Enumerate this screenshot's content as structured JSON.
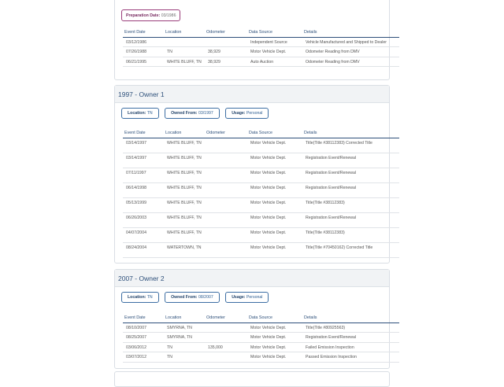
{
  "card0": {
    "prep_label": "Preparation Date:",
    "prep_value": "03/1986",
    "headers": [
      "Event Date",
      "Location",
      "Odometer",
      "Data Source",
      "Details"
    ],
    "rows": [
      [
        "03/12/1986",
        "",
        "",
        "Independent Source",
        "Vehicle Manufactured and Shipped to Dealer"
      ],
      [
        "07/26/1988",
        "TN",
        "38,929",
        "Motor Vehicle Dept.",
        "Odometer Reading from DMV"
      ],
      [
        "06/21/1995",
        "WHITE BLUFF, TN",
        "38,929",
        "Auto Auction",
        "Odometer Reading from DMV"
      ]
    ]
  },
  "owner1": {
    "title": "1997 - Owner   1",
    "location_label": "Location:",
    "location_value": "TN",
    "owned_label": "Owned From:",
    "owned_value": "03/1997",
    "usage_label": "Usage:",
    "usage_value": "Personal",
    "headers": [
      "Event Date",
      "Location",
      "Odometer",
      "Data Source",
      "Details"
    ],
    "rows": [
      [
        "03/14/1997",
        "WHITE BLUFF, TN",
        "",
        "Motor Vehicle Dept.",
        "Title(Title #38112383) Corrected Title"
      ],
      [
        "03/14/1997",
        "WHITE BLUFF, TN",
        "",
        "Motor Vehicle Dept.",
        "Registration Event/Renewal"
      ],
      [
        "07/11/1997",
        "WHITE BLUFF, TN",
        "",
        "Motor Vehicle Dept.",
        "Registration Event/Renewal"
      ],
      [
        "06/14/1998",
        "WHITE BLUFF, TN",
        "",
        "Motor Vehicle Dept.",
        "Registration Event/Renewal"
      ],
      [
        "05/13/1999",
        "WHITE BLUFF, TN",
        "",
        "Motor Vehicle Dept.",
        "Title(Title #38112383)"
      ],
      [
        "06/26/2003",
        "WHITE BLUFF, TN",
        "",
        "Motor Vehicle Dept.",
        "Registration Event/Renewal"
      ],
      [
        "04/07/2004",
        "WHITE BLUFF, TN",
        "",
        "Motor Vehicle Dept.",
        "Title(Title #38112383)"
      ],
      [
        "08/24/2004",
        "WATERTOWN, TN",
        "",
        "Motor Vehicle Dept.",
        "Title(Title #70450162) Corrected Title"
      ]
    ]
  },
  "owner2": {
    "title": "2007 - Owner   2",
    "location_label": "Location:",
    "location_value": "TN",
    "owned_label": "Owned From:",
    "owned_value": "08/2007",
    "usage_label": "Usage:",
    "usage_value": "Personal",
    "headers": [
      "Event Date",
      "Location",
      "Odometer",
      "Data Source",
      "Details"
    ],
    "rows": [
      [
        "08/10/2007",
        "SMYRNA, TN",
        "",
        "Motor Vehicle Dept.",
        "Title(Title #80925563)"
      ],
      [
        "08/25/2007",
        "SMYRNA, TN",
        "",
        "Motor Vehicle Dept.",
        "Registration Event/Renewal"
      ],
      [
        "03/06/2012",
        "TN",
        "135,000",
        "Motor Vehicle Dept.",
        "Failed Emission Inspection"
      ],
      [
        "03/07/2012",
        "TN",
        "",
        "Motor Vehicle Dept.",
        "Passed Emission Inspection"
      ]
    ]
  }
}
